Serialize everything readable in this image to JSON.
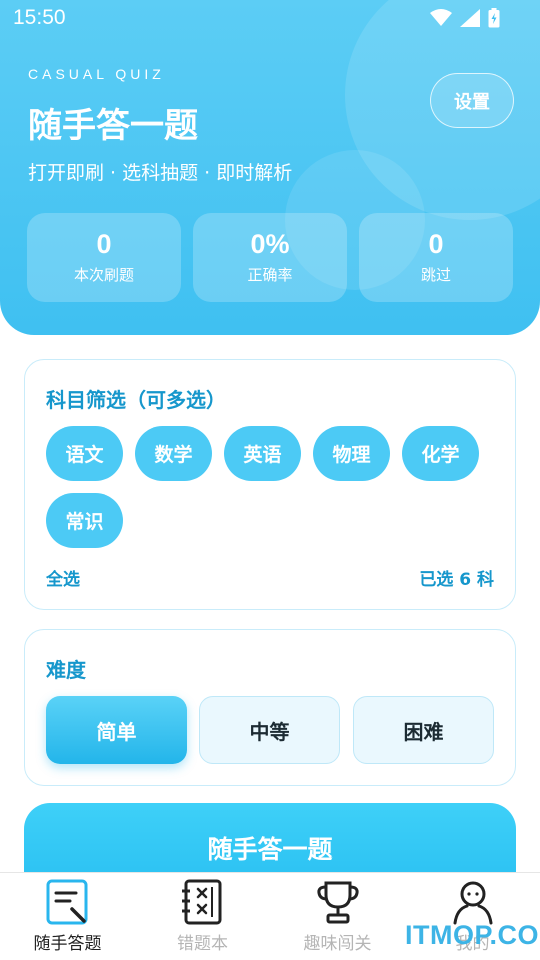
{
  "status_bar": {
    "time": "15:50"
  },
  "header": {
    "eyebrow": "CASUAL QUIZ",
    "title": "随手答一题",
    "subtitle": "打开即刷 · 选科抽题 · 即时解析",
    "settings_label": "设置"
  },
  "stats": [
    {
      "value": "0",
      "label": "本次刷题"
    },
    {
      "value": "0%",
      "label": "正确率"
    },
    {
      "value": "0",
      "label": "跳过"
    }
  ],
  "subject_filter": {
    "title": "科目筛选（可多选）",
    "subjects": [
      "语文",
      "数学",
      "英语",
      "物理",
      "化学",
      "常识"
    ],
    "select_all_label": "全选",
    "selected_count_text": "已选 6 科"
  },
  "difficulty": {
    "title": "难度",
    "options": [
      "简单",
      "中等",
      "困难"
    ],
    "selected": "简单"
  },
  "start_button_label": "随手答一题",
  "tabs": [
    {
      "label": "随手答题",
      "icon": "quiz-edit-icon",
      "active": true
    },
    {
      "label": "错题本",
      "icon": "mistake-notebook-icon",
      "active": false
    },
    {
      "label": "趣味闯关",
      "icon": "trophy-icon",
      "active": false
    },
    {
      "label": "我的",
      "icon": "profile-icon",
      "active": false
    }
  ],
  "watermark": "ITMOP.COM",
  "colors": {
    "primary": "#3fc0f1",
    "accent_text": "#1697cc",
    "chip": "#4ccaf5"
  }
}
